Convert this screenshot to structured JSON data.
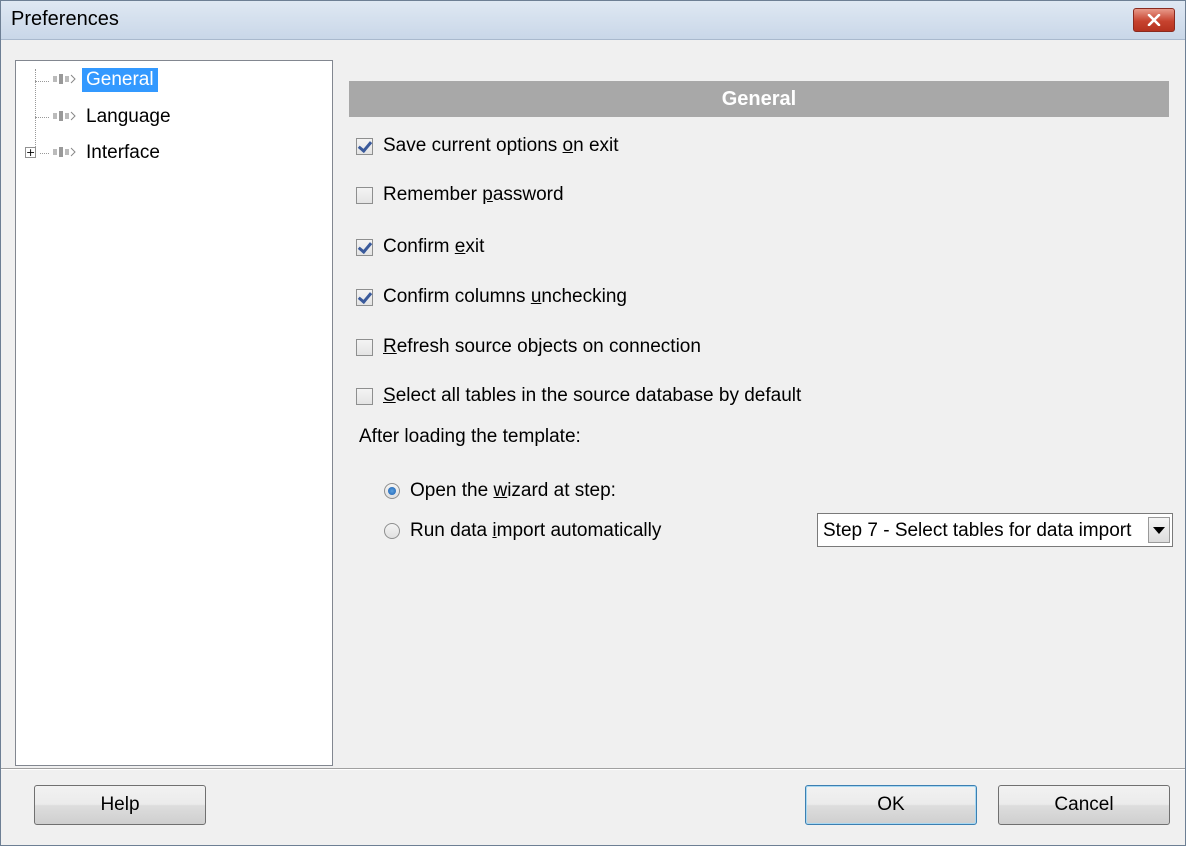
{
  "window": {
    "title": "Preferences"
  },
  "tree": {
    "items": [
      {
        "label": "General",
        "selected": true
      },
      {
        "label": "Language",
        "selected": false
      },
      {
        "label": "Interface",
        "selected": false,
        "expandable": true
      }
    ]
  },
  "main": {
    "section_title": "General",
    "options": [
      {
        "pre": "Save current options ",
        "accel": "o",
        "post": "n exit",
        "checked": true
      },
      {
        "pre": "Remember ",
        "accel": "p",
        "post": "assword",
        "checked": false
      },
      {
        "pre": "Confirm ",
        "accel": "e",
        "post": "xit",
        "checked": true
      },
      {
        "pre": "Confirm columns ",
        "accel": "u",
        "post": "nchecking",
        "checked": true
      },
      {
        "pre": "",
        "accel": "R",
        "post": "efresh source objects on connection",
        "checked": false
      },
      {
        "pre": "",
        "accel": "S",
        "post": "elect all tables in the source database by default",
        "checked": false
      }
    ],
    "after_loading_label": "After loading the template:",
    "radios": [
      {
        "pre": "Open the ",
        "accel": "w",
        "post": "izard at step:",
        "selected": true
      },
      {
        "pre": "Run data ",
        "accel": "i",
        "post": "mport automatically",
        "selected": false
      }
    ],
    "step_select": {
      "value": "Step 7 - Select tables for data import"
    }
  },
  "buttons": {
    "help": "Help",
    "ok": "OK",
    "cancel": "Cancel"
  },
  "colors": {
    "selection": "#3399ff",
    "header_bg": "#a8a8a8",
    "close_red": "#c7432f"
  }
}
